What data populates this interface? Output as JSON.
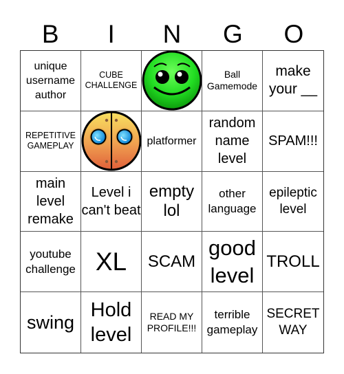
{
  "header": {
    "letters": [
      "B",
      "I",
      "N",
      "G",
      "O"
    ]
  },
  "cells": [
    {
      "text": "unique username author"
    },
    {
      "text": "CUBE CHALLENGE"
    },
    {
      "image": "green-cube-face-icon"
    },
    {
      "text": "Ball Gamemode"
    },
    {
      "text": "make your __"
    },
    {
      "text": "REPETITIVE GAMEPLAY"
    },
    {
      "image": "orange-robot-face-icon"
    },
    {
      "text": "platformer"
    },
    {
      "text": "random name level"
    },
    {
      "text": "SPAM!!!"
    },
    {
      "text": "main level remake"
    },
    {
      "text": "Level i can't beat"
    },
    {
      "text": "empty lol"
    },
    {
      "text": "other language"
    },
    {
      "text": "epileptic level"
    },
    {
      "text": "youtube challenge"
    },
    {
      "text": "XL"
    },
    {
      "text": "SCAM"
    },
    {
      "text": "good level"
    },
    {
      "text": "TROLL"
    },
    {
      "text": "swing"
    },
    {
      "text": "Hold level"
    },
    {
      "text": "READ MY PROFILE!!!"
    },
    {
      "text": "terrible gameplay"
    },
    {
      "text": "SECRET WAY"
    }
  ],
  "colors": {
    "green_face": "#22dd22",
    "orange_face_top": "#f5d35a",
    "orange_face_bottom": "#e0603a",
    "eye_blue": "#1aa6f0"
  }
}
